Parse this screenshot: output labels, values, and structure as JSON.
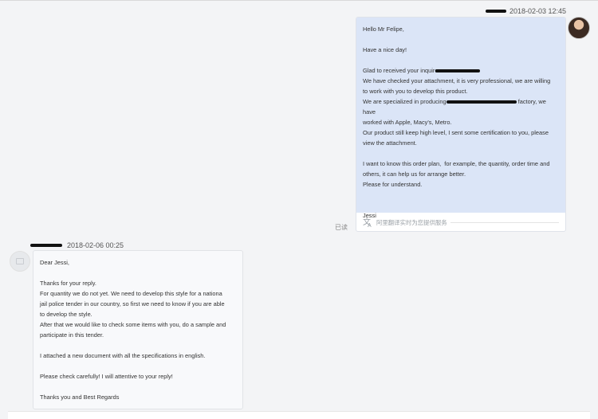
{
  "outgoing": {
    "timestamp": "2018-02-03 12:45",
    "lines": [
      "Hello Mr Felipe,",
      "",
      "Have a nice day!",
      "",
      "Glad to received your inquire on",
      "We have checked your attachment, it is very professional, we are willing",
      "to work with you to develop this product.",
      "We are specialized in producing",
      "worked with Apple, Macy's, Metro.",
      "Our product still keep high level, I sent some certification to you, please",
      "view the attachment.",
      "",
      "I want to know this order plan,  for example, the quantity, order time and",
      "others, it can help us for arrange better.",
      "Please for understand.",
      "",
      "",
      "Jessi"
    ],
    "line8_suffix": "factory, we have",
    "translate_text": "阿里翻译实时为您提供服务",
    "read_status": "已读"
  },
  "incoming": {
    "timestamp": "2018-02-06 00:25",
    "lines": [
      "Dear Jessi,",
      "",
      "Thanks for your reply.",
      "For quantity we do not yet. We need to develop this style for a nationa",
      "jail police tender in our country, so first we need to know if you are able",
      "to develop the style.",
      "After that we would like to check some items with you, do a sample and",
      "participate in this tender.",
      "",
      "I attached a new document with all the specifications in english.",
      "",
      "Please check carefully! I will attentive to your reply!",
      "",
      "Thanks you and Best Regards"
    ]
  }
}
